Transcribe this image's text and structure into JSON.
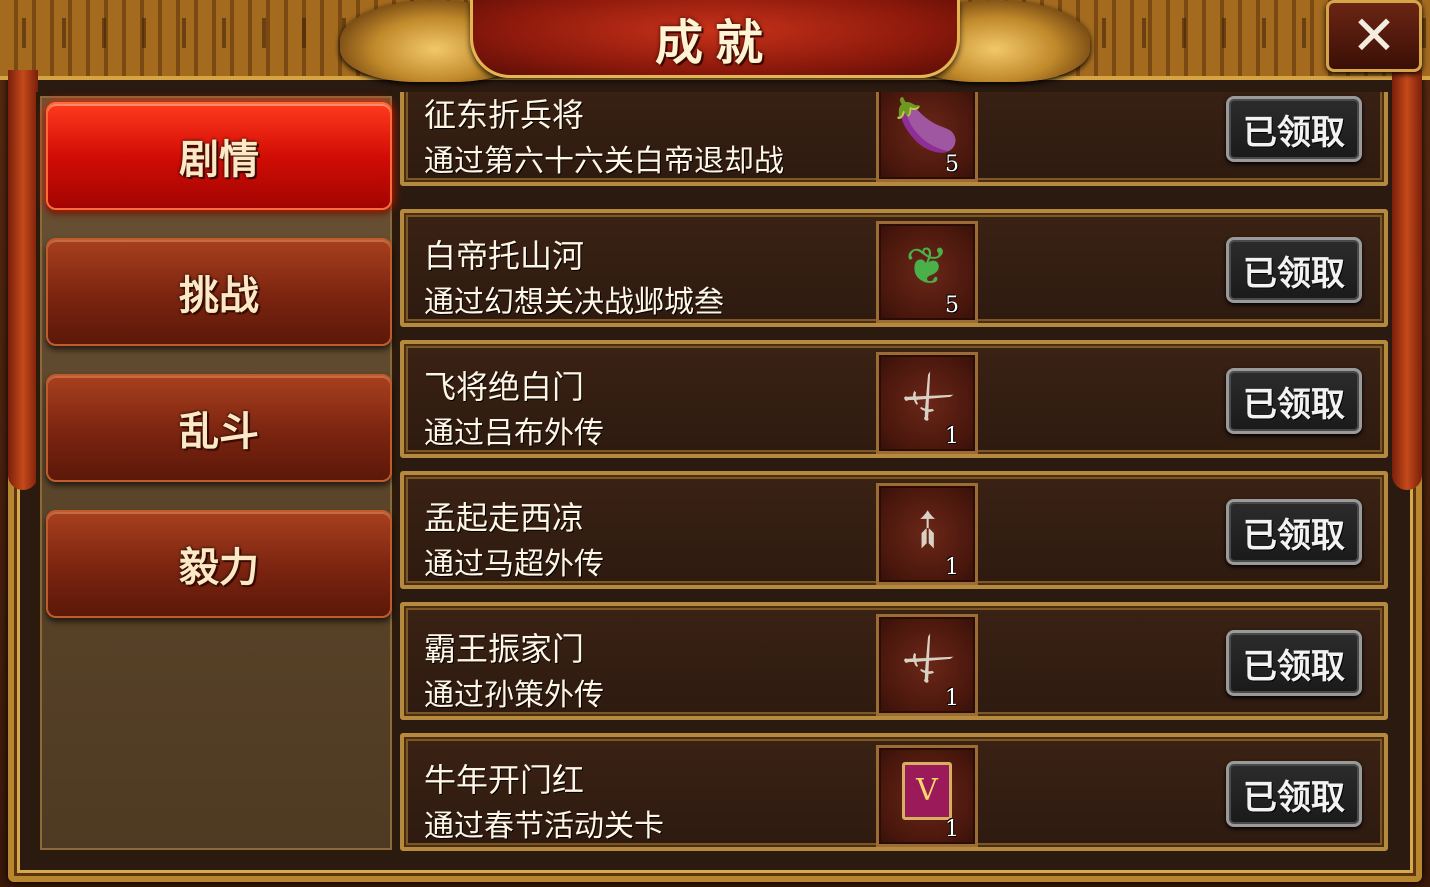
{
  "dialog": {
    "title": "成就",
    "close_icon": "close-icon"
  },
  "tabs": [
    {
      "label": "剧情",
      "active": true
    },
    {
      "label": "挑战",
      "active": false
    },
    {
      "label": "乱斗",
      "active": false
    },
    {
      "label": "毅力",
      "active": false
    }
  ],
  "achievements": [
    {
      "title": "征东折兵将",
      "desc": "通过第六十六关白帝退却战",
      "reward_icon": "eggplant-icon",
      "qty": "5",
      "button": "已领取"
    },
    {
      "title": "白帝托山河",
      "desc": "通过幻想关决战邺城叁",
      "reward_icon": "seed-icon",
      "qty": "5",
      "button": "已领取"
    },
    {
      "title": "飞将绝白门",
      "desc": "通过吕布外传",
      "reward_icon": "halberd-icon",
      "qty": "1",
      "button": "已领取"
    },
    {
      "title": "孟起走西凉",
      "desc": "通过马超外传",
      "reward_icon": "spear-icon",
      "qty": "1",
      "button": "已领取"
    },
    {
      "title": "霸王振家门",
      "desc": "通过孙策外传",
      "reward_icon": "halberd-icon",
      "qty": "1",
      "button": "已领取"
    },
    {
      "title": "牛年开门红",
      "desc": "通过春节活动关卡",
      "reward_icon": "book-icon",
      "qty": "1",
      "button": "已领取"
    }
  ]
}
